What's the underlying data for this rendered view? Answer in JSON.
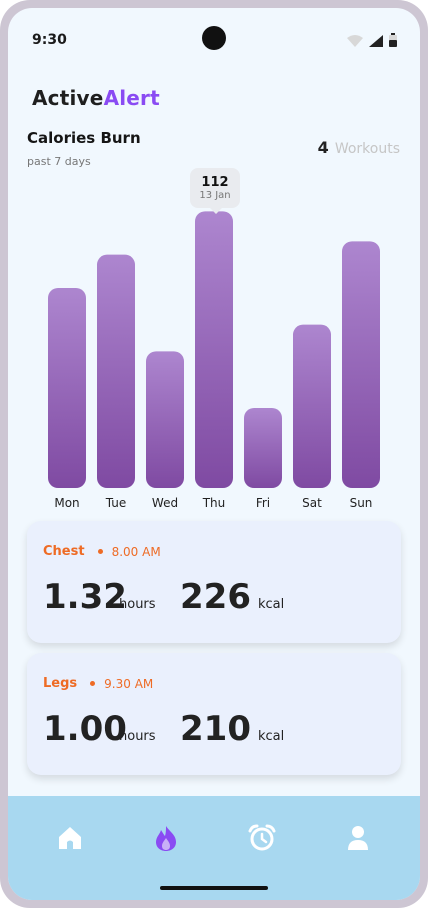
{
  "status": {
    "time": "9:30"
  },
  "brand": {
    "part1": "Active",
    "part2": "Alert"
  },
  "section": {
    "title": "Calories Burn",
    "subtitle": "past 7 days"
  },
  "workouts": {
    "count": "4",
    "label": "Workouts"
  },
  "tooltip": {
    "value": "112",
    "date": "13 Jan"
  },
  "chart_data": {
    "type": "bar",
    "categories": [
      "Mon",
      "Tue",
      "Wed",
      "Thu",
      "Fri",
      "Sat",
      "Sun"
    ],
    "values": [
      60,
      70,
      41,
      83,
      24,
      49,
      74
    ],
    "ylim": [
      0,
      90
    ],
    "highlight_index": 3
  },
  "cards": [
    {
      "name": "Chest",
      "time": "8.00 AM",
      "duration": "1.32",
      "duration_unit": "hours",
      "calories": "226",
      "calories_unit": "kcal"
    },
    {
      "name": "Legs",
      "time": "9.30 AM",
      "duration": "1.00",
      "duration_unit": "hours",
      "calories": "210",
      "calories_unit": "kcal"
    }
  ],
  "nav": {
    "items": [
      "home-icon",
      "fire-icon",
      "alarm-icon",
      "profile-icon"
    ],
    "active_index": 1
  },
  "colors": {
    "accent": "#8a4bf3",
    "bar_top": "#ad86cf",
    "bar_bottom": "#7f4aa2",
    "card_label": "#ee6b25",
    "nav_bg": "#a8d8f0"
  }
}
